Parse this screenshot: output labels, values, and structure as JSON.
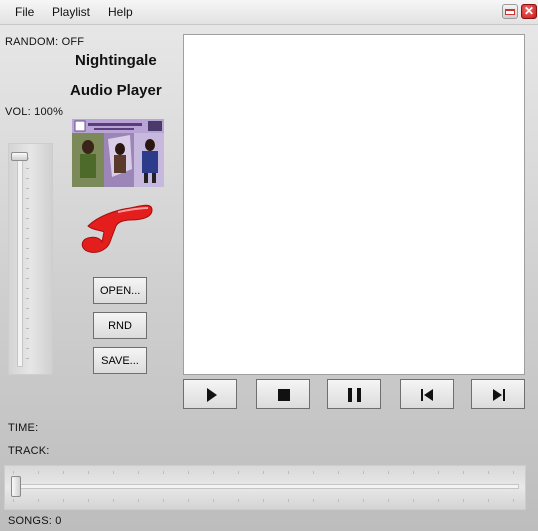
{
  "menubar": {
    "items": [
      {
        "label": "File"
      },
      {
        "label": "Playlist"
      },
      {
        "label": "Help"
      }
    ],
    "close_glyph": "✕"
  },
  "status": {
    "random": "RANDOM: OFF",
    "volume": "VOL: 100%",
    "time": "TIME:",
    "track": "TRACK:",
    "songs": "SONGS: 0"
  },
  "app_title": {
    "line1": "Nightingale",
    "line2": "Audio Player"
  },
  "volume_slider": {
    "level": 1.0
  },
  "side_buttons": {
    "open": "OPEN...",
    "random": "RND",
    "save": "SAVE..."
  },
  "transport": {
    "play_icon": "play-icon",
    "stop_icon": "stop-icon",
    "pause_icon": "pause-icon",
    "prev_icon": "previous-icon",
    "next_icon": "next-icon"
  },
  "seek_slider": {
    "position": 0.0
  },
  "playlist": {
    "items": []
  },
  "colors": {
    "close_button": "#c81818",
    "music_note": "#e41d1d",
    "playlist_bg": "#ffffff"
  }
}
